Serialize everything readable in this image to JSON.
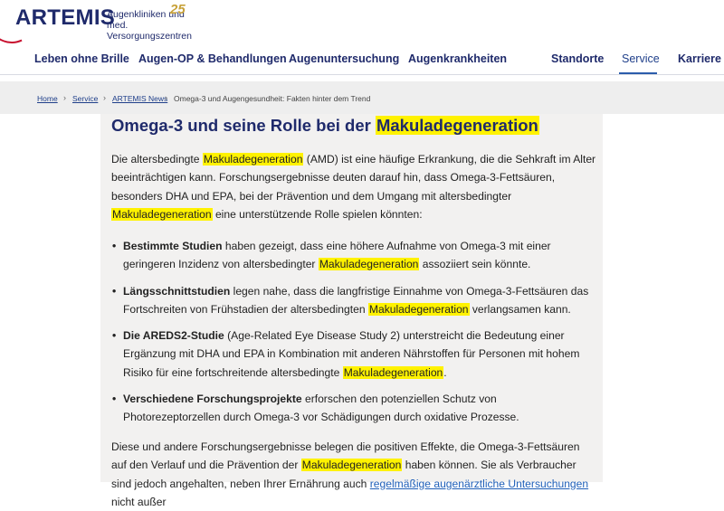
{
  "brand": {
    "name": "ARTEMIS",
    "tagline_line1": "Augenkliniken und",
    "tagline_line2": "med. Versorgungszentren",
    "anniversary": "25",
    "colors": {
      "primary": "#1f2a6b",
      "accent": "#c8102e",
      "highlight": "#fff200"
    }
  },
  "nav": {
    "items": [
      {
        "label": "Leben ohne Brille"
      },
      {
        "label": "Augen-OP & Behandlungen"
      },
      {
        "label": "Augenuntersuchung"
      },
      {
        "label": "Augenkrankheiten"
      },
      {
        "label": "Standorte"
      },
      {
        "label": "Service",
        "active": true
      },
      {
        "label": "Karriere"
      }
    ]
  },
  "breadcrumb": {
    "items": [
      "Home",
      "Service",
      "ARTEMIS News"
    ],
    "current": "Omega-3 und Augengesundheit: Fakten hinter dem Trend",
    "separator": "›"
  },
  "article": {
    "heading_pre": "Omega-3 und seine Rolle bei der ",
    "heading_hl": "Makuladegeneration",
    "p1": {
      "a": "Die altersbedingte ",
      "hl1": "Makuladegeneration",
      "b": " (AMD) ist eine häufige Erkrankung, die die Sehkraft im Alter beeinträchtigen kann. Forschungsergebnisse deuten darauf hin, dass Omega-3-Fettsäuren, besonders DHA und EPA, bei der Prävention und dem Umgang mit altersbedingter ",
      "hl2": "Makuladegeneration",
      "c": " eine unterstützende Rolle spielen könnten:"
    },
    "bullets": [
      {
        "bold": "Bestimmte Studien",
        "a": " haben gezeigt, dass eine höhere Aufnahme von Omega-3 mit einer geringeren Inzidenz von altersbedingter ",
        "hl": "Makuladegeneration",
        "b": " assoziiert sein könnte."
      },
      {
        "bold": "Längsschnittstudien",
        "a": " legen nahe, dass die langfristige Einnahme von Omega-3-Fettsäuren das Fortschreiten von Frühstadien der altersbedingten ",
        "hl": "Makuladegeneration",
        "b": " verlangsamen kann."
      },
      {
        "bold": "Die AREDS2-Studie",
        "a": " (Age-Related Eye Disease Study 2) unterstreicht die Bedeutung einer Ergänzung mit DHA und EPA in Kombination mit anderen Nährstoffen für Personen mit hohem Risiko für eine fortschreitende altersbedingte ",
        "hl": "Makuladegeneration",
        "b": "."
      },
      {
        "bold": "Verschiedene Forschungsprojekte",
        "a": " erforschen den potenziellen Schutz von Photorezeptorzellen durch Omega-3 vor Schädigungen durch oxidative Prozesse.",
        "hl": "",
        "b": ""
      }
    ],
    "p2": {
      "a": "Diese und andere Forschungsergebnisse belegen die positiven Effekte, die Omega-3-Fettsäuren auf den Verlauf und die Prävention der ",
      "hl": "Makuladegeneration",
      "b": " haben können. Sie als Verbraucher sind jedoch angehalten, neben Ihrer Ernährung auch ",
      "link": "regelmäßige augenärztliche Untersuchungen",
      "c": " nicht außer"
    }
  }
}
